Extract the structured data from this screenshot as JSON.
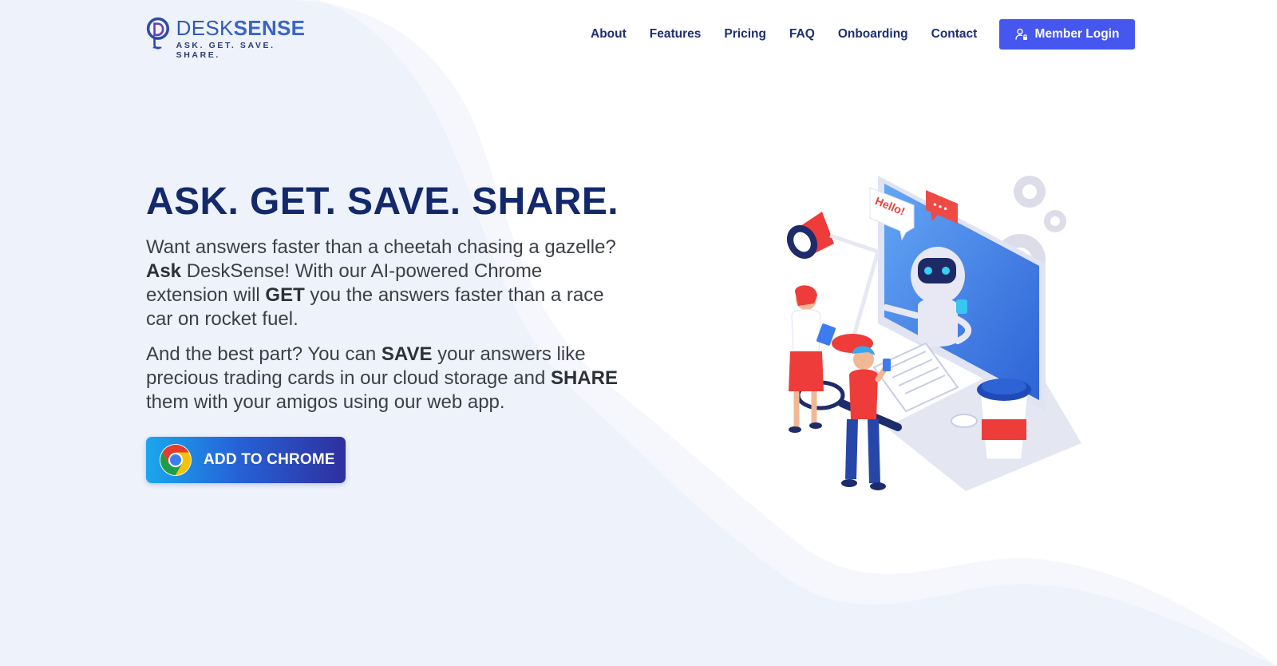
{
  "brand": {
    "name_part1": "DESK",
    "name_part2": "SENSE",
    "tagline": "ASK. GET. SAVE. SHARE."
  },
  "nav": {
    "items": [
      {
        "label": "About"
      },
      {
        "label": "Features"
      },
      {
        "label": "Pricing"
      },
      {
        "label": "FAQ"
      },
      {
        "label": "Onboarding"
      },
      {
        "label": "Contact"
      }
    ],
    "login_label": "Member Login"
  },
  "hero": {
    "title": "ASK. GET. SAVE. SHARE.",
    "p1": {
      "t1": "Want answers faster than a cheetah chasing a gazelle? ",
      "b1": "Ask",
      "t2": " DeskSense! With our AI-powered Chrome extension will ",
      "b2": "GET",
      "t3": " you the answers faster than a race car on rocket fuel."
    },
    "p2": {
      "t1": "And the best part? You can ",
      "b1": "SAVE",
      "t2": " your answers like precious trading cards in our cloud storage and ",
      "b2": "SHARE",
      "t3": " them with your amigos using our web app."
    },
    "cta_label": "ADD TO CHROME"
  },
  "illustration": {
    "bubble_text": "Hello!",
    "ellipsis": "•••"
  },
  "colors": {
    "navy": "#13296b",
    "nav_text": "#1e2f73",
    "accent": "#4557ee",
    "background_wave": "#eef2fa"
  },
  "icons": [
    "desksense-logo-icon",
    "user-lock-icon",
    "chrome-icon"
  ]
}
